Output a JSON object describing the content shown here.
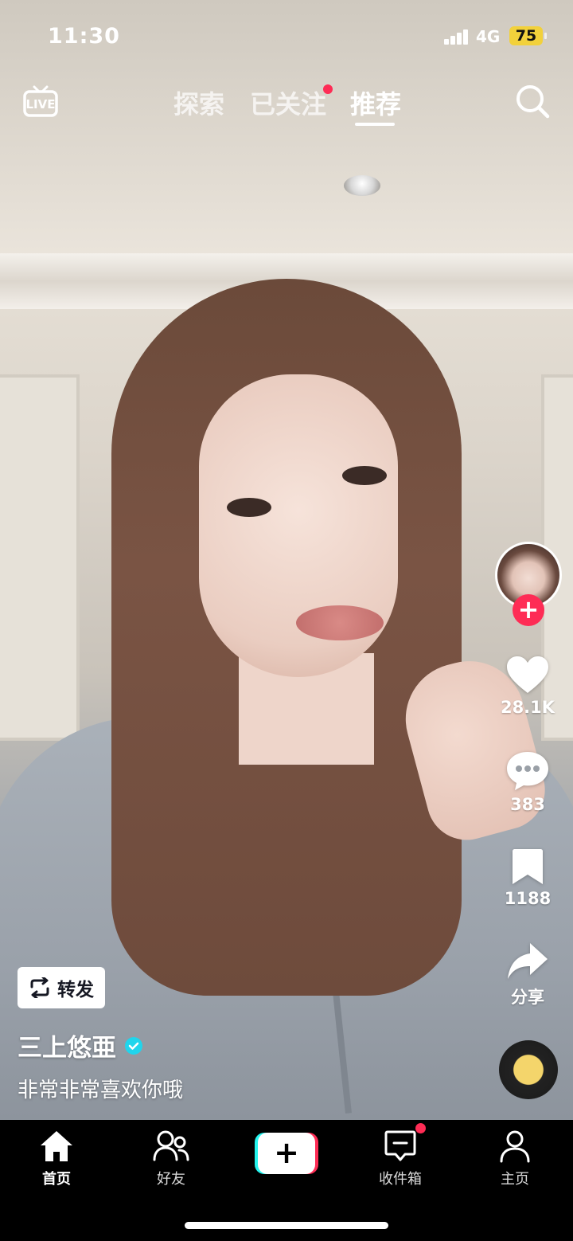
{
  "status_bar": {
    "time": "11:30",
    "network": "4G",
    "battery": "75"
  },
  "top_nav": {
    "tabs": [
      {
        "label": "探索"
      },
      {
        "label": "已关注"
      },
      {
        "label": "推荐"
      }
    ],
    "active_tab": "推荐"
  },
  "rail": {
    "likes": "28.1K",
    "comments": "383",
    "favorites": "1188",
    "share_label": "分享"
  },
  "post": {
    "repost_label": "转发",
    "author": "三上悠亜",
    "caption": "非常非常喜欢你哦"
  },
  "bottom_nav": {
    "items": [
      {
        "label": "首页",
        "icon": "home-icon"
      },
      {
        "label": "好友",
        "icon": "friends-icon"
      },
      {
        "label": "",
        "icon": "create-icon"
      },
      {
        "label": "收件箱",
        "icon": "inbox-icon"
      },
      {
        "label": "主页",
        "icon": "profile-icon"
      }
    ]
  },
  "colors": {
    "accent": "#fe2c55",
    "cyan": "#25f4ee",
    "battery": "#f2d13b",
    "verified": "#20d5ec"
  }
}
